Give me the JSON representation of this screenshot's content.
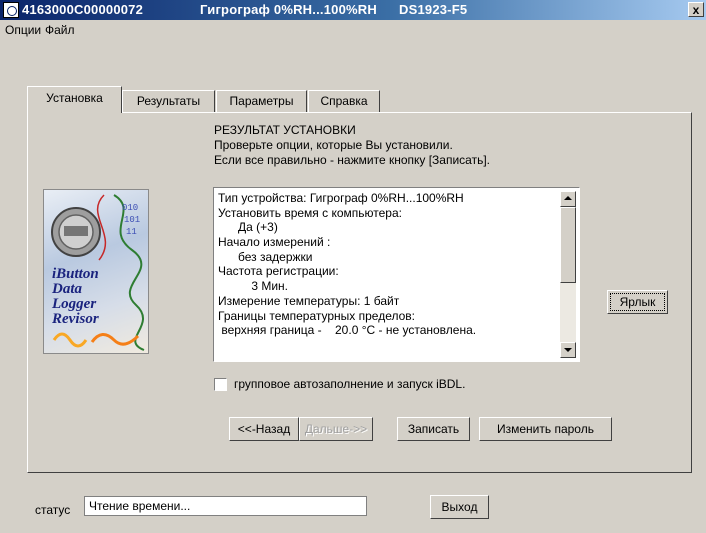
{
  "window": {
    "title_id": "4163000C00000072",
    "title_device": "Гигрограф 0%RH...100%RH",
    "title_model": "DS1923-F5",
    "close_label": "x"
  },
  "menu": {
    "items": [
      "Опции",
      "Файл"
    ]
  },
  "tabs": [
    {
      "label": "Установка",
      "active": true
    },
    {
      "label": "Результаты",
      "active": false
    },
    {
      "label": "Параметры",
      "active": false
    },
    {
      "label": "Справка",
      "active": false
    }
  ],
  "setup": {
    "heading": "РЕЗУЛЬТАТ УСТАНОВКИ",
    "line1": "Проверьте опции, которые Вы установили.",
    "line2": "Если все правильно - нажмите кнопку [Записать]."
  },
  "logo": {
    "lines": [
      "iButton",
      "Data",
      "Logger",
      "Revisor"
    ]
  },
  "summary": [
    "Тип устройства: Гигрограф 0%RH...100%RH",
    "Установить время с компьютера:",
    "      Да (+3)",
    "Начало измерений :",
    "      без задержки",
    "Частота регистрации:",
    "          3 Мин.",
    "Измерение температуры: 1 байт",
    "Границы температурных пределов:",
    " верхняя граница -    20.0 °C - не установлена."
  ],
  "shortcut_button": "Ярлык",
  "group_autofill": {
    "label": "групповое автозаполнение и запуск iBDL.",
    "checked": false
  },
  "nav": {
    "back": "<<-Назад",
    "next": "Дальше->>",
    "write": "Записать",
    "change_password": "Изменить пароль"
  },
  "status": {
    "label": "статус",
    "value": "Чтение времени..."
  },
  "exit_button": "Выход"
}
